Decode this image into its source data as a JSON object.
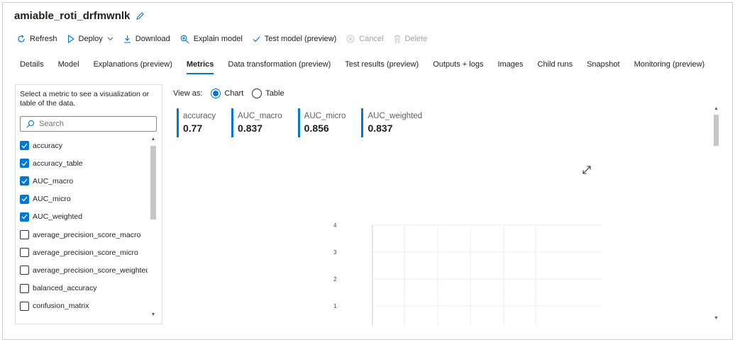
{
  "header": {
    "title": "amiable_roti_drfmwnlk"
  },
  "toolbar": {
    "refresh": "Refresh",
    "deploy": "Deploy",
    "download": "Download",
    "explain": "Explain model",
    "test": "Test model (preview)",
    "cancel": "Cancel",
    "delete": "Delete"
  },
  "tabs": [
    "Details",
    "Model",
    "Explanations (preview)",
    "Metrics",
    "Data transformation (preview)",
    "Test results (preview)",
    "Outputs + logs",
    "Images",
    "Child runs",
    "Snapshot",
    "Monitoring (preview)"
  ],
  "active_tab": "Metrics",
  "left": {
    "hint": "Select a metric to see a visualization or table of the data.",
    "search_placeholder": "Search",
    "metrics": [
      {
        "label": "accuracy",
        "checked": true
      },
      {
        "label": "accuracy_table",
        "checked": true
      },
      {
        "label": "AUC_macro",
        "checked": true
      },
      {
        "label": "AUC_micro",
        "checked": true
      },
      {
        "label": "AUC_weighted",
        "checked": true
      },
      {
        "label": "average_precision_score_macro",
        "checked": false
      },
      {
        "label": "average_precision_score_micro",
        "checked": false
      },
      {
        "label": "average_precision_score_weighted",
        "checked": false
      },
      {
        "label": "balanced_accuracy",
        "checked": false
      },
      {
        "label": "confusion_matrix",
        "checked": false
      }
    ]
  },
  "view": {
    "label": "View as:",
    "chart": "Chart",
    "table": "Table",
    "selected": "Chart"
  },
  "kpis": [
    {
      "label": "accuracy",
      "value": "0.77"
    },
    {
      "label": "AUC_macro",
      "value": "0.837"
    },
    {
      "label": "AUC_micro",
      "value": "0.856"
    },
    {
      "label": "AUC_weighted",
      "value": "0.837"
    }
  ],
  "chart_data": {
    "type": "line",
    "y_ticks": [
      "4",
      "3",
      "2",
      "1"
    ],
    "grid": true
  },
  "colors": {
    "accent": "#0078d4"
  }
}
